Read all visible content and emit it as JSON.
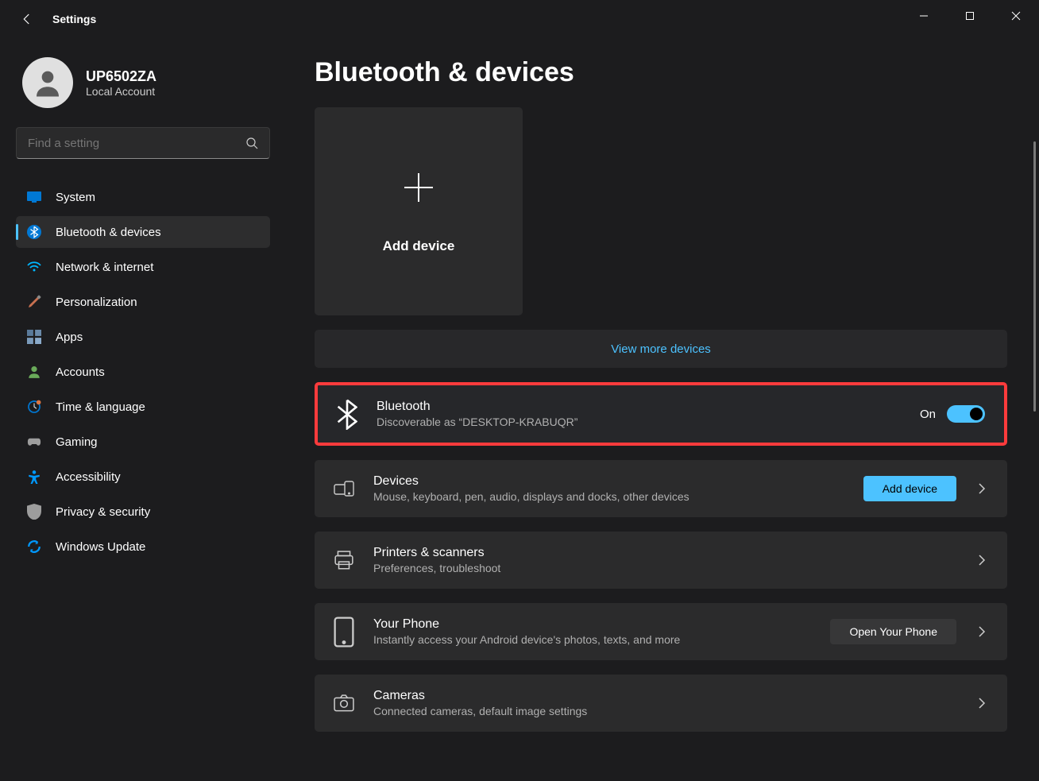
{
  "app": {
    "title": "Settings"
  },
  "profile": {
    "name": "UP6502ZA",
    "sub": "Local Account"
  },
  "search": {
    "placeholder": "Find a setting"
  },
  "nav": [
    {
      "label": "System"
    },
    {
      "label": "Bluetooth & devices"
    },
    {
      "label": "Network & internet"
    },
    {
      "label": "Personalization"
    },
    {
      "label": "Apps"
    },
    {
      "label": "Accounts"
    },
    {
      "label": "Time & language"
    },
    {
      "label": "Gaming"
    },
    {
      "label": "Accessibility"
    },
    {
      "label": "Privacy & security"
    },
    {
      "label": "Windows Update"
    }
  ],
  "page": {
    "title": "Bluetooth & devices",
    "add_tile": "Add device",
    "view_more": "View more devices",
    "bluetooth": {
      "title": "Bluetooth",
      "sub": "Discoverable as “DESKTOP-KRABUQR”",
      "state": "On"
    },
    "devices": {
      "title": "Devices",
      "sub": "Mouse, keyboard, pen, audio, displays and docks, other devices",
      "btn": "Add device"
    },
    "printers": {
      "title": "Printers & scanners",
      "sub": "Preferences, troubleshoot"
    },
    "phone": {
      "title": "Your Phone",
      "sub": "Instantly access your Android device's photos, texts, and more",
      "btn": "Open Your Phone"
    },
    "cameras": {
      "title": "Cameras",
      "sub": "Connected cameras, default image settings"
    }
  }
}
